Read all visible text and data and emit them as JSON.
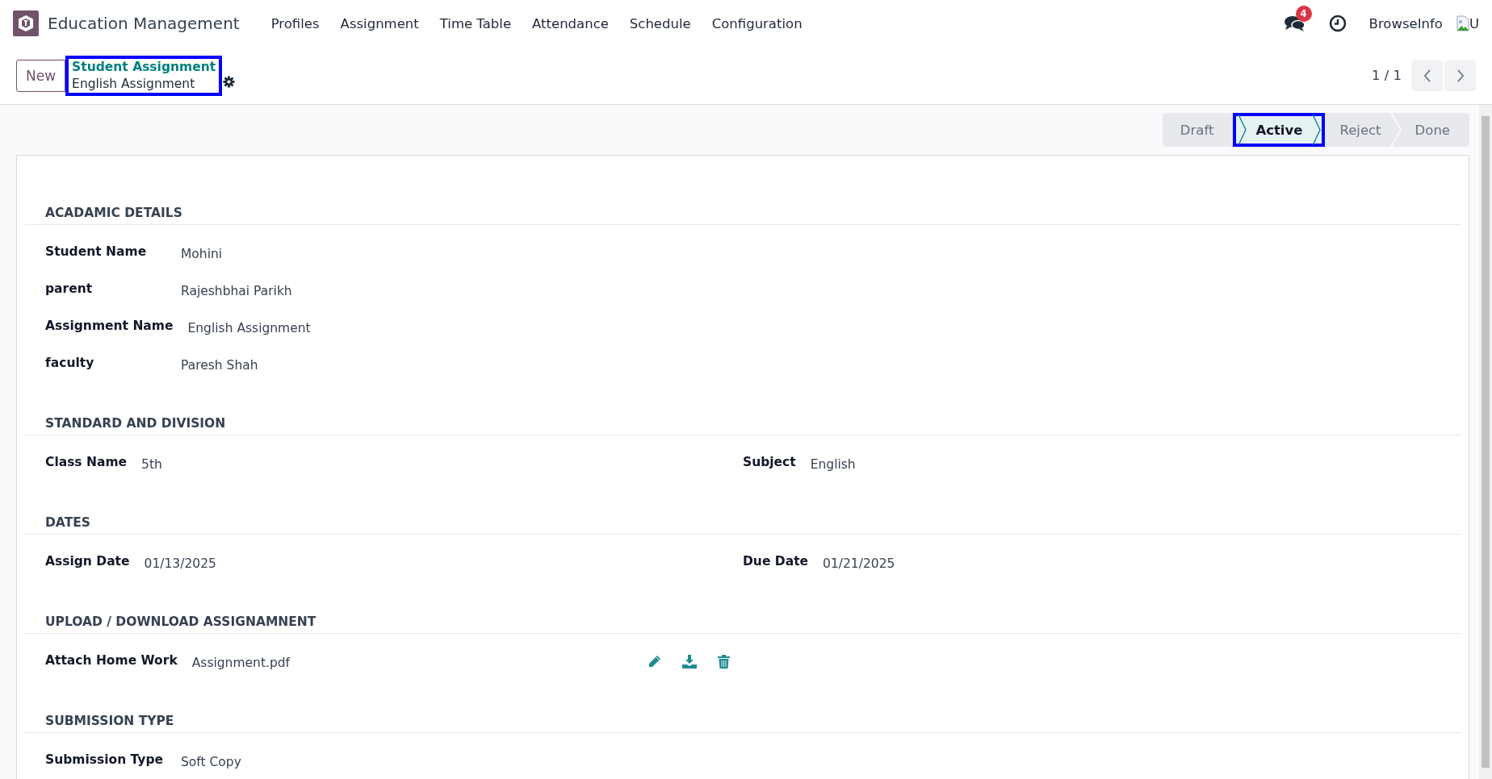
{
  "navbar": {
    "app_name": "Education Management",
    "menu": [
      "Profiles",
      "Assignment",
      "Time Table",
      "Attendance",
      "Schedule",
      "Configuration"
    ],
    "message_count": "4",
    "user_name": "BrowseInfo",
    "avatar_text": "U"
  },
  "control_panel": {
    "new_button": "New",
    "breadcrumb": {
      "parent": "Student Assignment",
      "current": "English Assignment",
      "highlighted": true
    },
    "pager": "1 / 1"
  },
  "stages": [
    {
      "label": "Draft",
      "selected": false,
      "highlighted": false
    },
    {
      "label": "Active",
      "selected": true,
      "highlighted": true
    },
    {
      "label": "Reject",
      "selected": false,
      "highlighted": false
    },
    {
      "label": "Done",
      "selected": false,
      "highlighted": false
    }
  ],
  "sections": [
    {
      "title": "ACADAMIC DETAILS",
      "fields": [
        {
          "label": "Student Name",
          "value": "Mohini",
          "kind": "text"
        },
        {
          "label": "parent",
          "value": "Rajeshbhai Parikh",
          "kind": "text"
        },
        {
          "label": "Assignment Name",
          "value": "English Assignment",
          "kind": "text"
        },
        {
          "label": "faculty",
          "value": "Paresh Shah",
          "kind": "text"
        }
      ]
    },
    {
      "title": "STANDARD AND DIVISION",
      "columns": [
        [
          {
            "label": "Class Name",
            "value": "5th",
            "kind": "text"
          }
        ],
        [
          {
            "label": "Subject",
            "value": "English",
            "kind": "text"
          }
        ]
      ]
    },
    {
      "title": "DATES",
      "columns": [
        [
          {
            "label": "Assign Date",
            "value": "01/13/2025",
            "kind": "text"
          }
        ],
        [
          {
            "label": "Due Date",
            "value": "01/21/2025",
            "kind": "text"
          }
        ]
      ]
    },
    {
      "title": "UPLOAD / DOWNLOAD ASSIGNAMNENT",
      "fields": [
        {
          "label": "Attach Home Work",
          "value": "Assignment.pdf",
          "kind": "file"
        }
      ]
    },
    {
      "title": "SUBMISSION TYPE",
      "fields": [
        {
          "label": "Submission Type",
          "value": "Soft Copy",
          "kind": "text"
        }
      ]
    }
  ]
}
